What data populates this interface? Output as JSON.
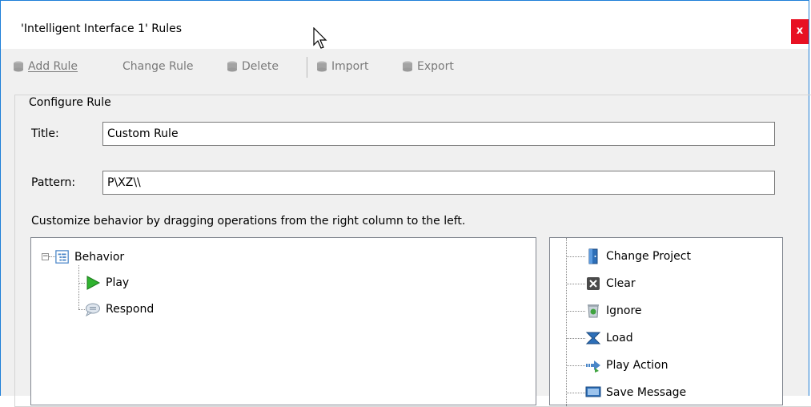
{
  "window": {
    "title": "'Intelligent Interface 1' Rules",
    "close_label": "x"
  },
  "toolbar": {
    "add_rule": "Add Rule",
    "change_rule": "Change Rule",
    "delete": "Delete",
    "import": "Import",
    "export": "Export"
  },
  "configure": {
    "group_label": "Configure Rule",
    "title_label": "Title:",
    "title_value": "Custom Rule",
    "pattern_label": "Pattern:",
    "pattern_value": "P\\XZ\\\\",
    "hint": "Customize behavior by dragging operations from the right column to the left."
  },
  "behavior_tree": {
    "root": {
      "label": "Behavior",
      "icon": "behavior-icon",
      "expander": "−"
    },
    "children": [
      {
        "label": "Play",
        "icon": "play-icon"
      },
      {
        "label": "Respond",
        "icon": "speech-bubble-icon"
      }
    ]
  },
  "operations": [
    {
      "label": "Change Project",
      "icon": "door-icon"
    },
    {
      "label": "Clear",
      "icon": "clear-icon"
    },
    {
      "label": "Ignore",
      "icon": "trash-icon"
    },
    {
      "label": "Load",
      "icon": "load-icon"
    },
    {
      "label": "Play Action",
      "icon": "arrow-icon"
    },
    {
      "label": "Save Message",
      "icon": "monitor-icon"
    }
  ],
  "colors": {
    "accent": "#1e7fd8",
    "close": "#e81123",
    "disabled_text": "#7a7a7a"
  }
}
